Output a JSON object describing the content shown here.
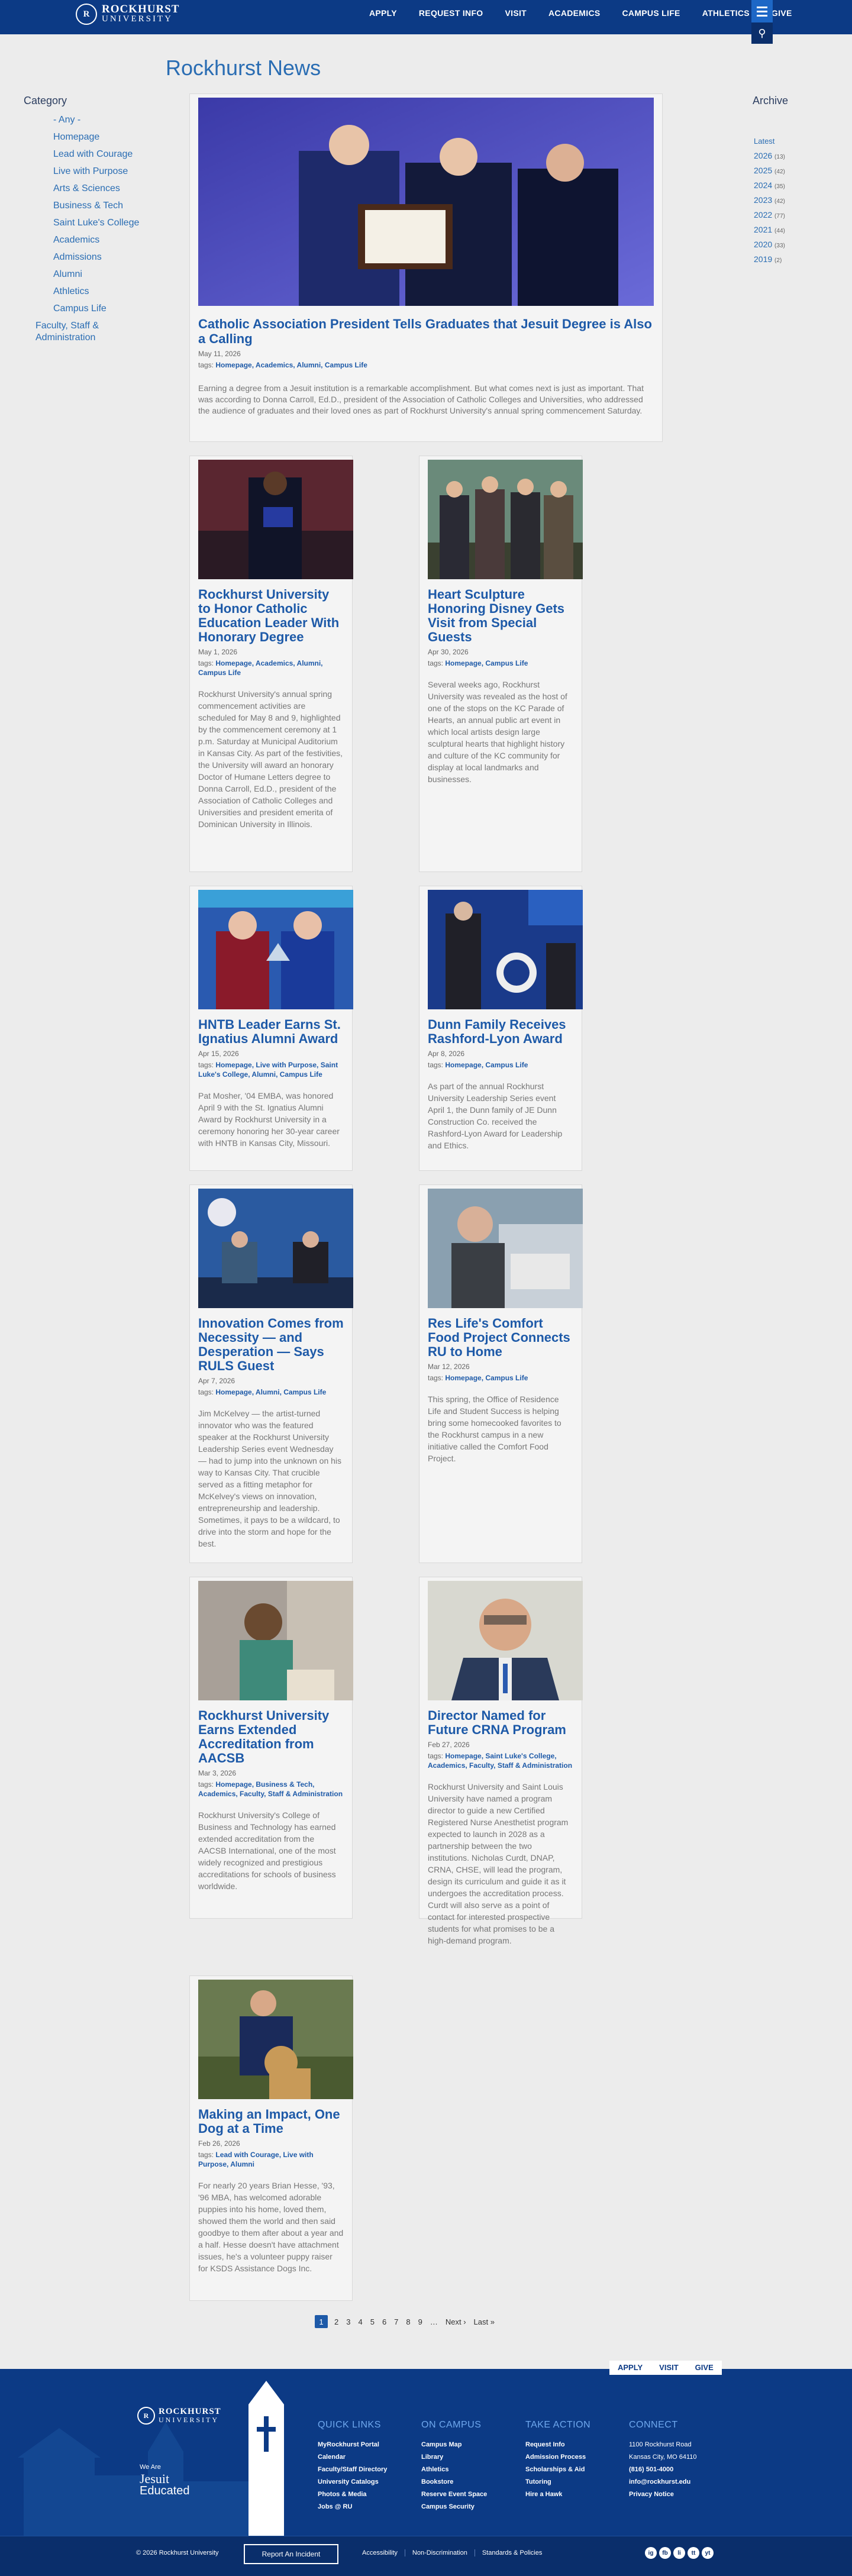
{
  "brand": {
    "name_line1": "ROCKHURST",
    "name_line2": "UNIVERSITY",
    "seal": "R"
  },
  "nav": [
    "APPLY",
    "REQUEST INFO",
    "VISIT",
    "ACADEMICS",
    "CAMPUS LIFE",
    "ATHLETICS",
    "GIVE"
  ],
  "page_title": "Rockhurst News",
  "category": {
    "heading": "Category",
    "items": [
      "- Any -",
      "Homepage",
      "Lead with Courage",
      "Live with Purpose",
      "Arts & Sciences",
      "Business & Tech",
      "Saint Luke's College",
      "Academics",
      "Admissions",
      "Alumni",
      "Athletics",
      "Campus Life",
      "Faculty, Staff & Administration"
    ]
  },
  "archive": {
    "heading": "Archive",
    "latest": "Latest",
    "years": [
      {
        "y": "2026",
        "c": "(13)"
      },
      {
        "y": "2025",
        "c": "(42)"
      },
      {
        "y": "2024",
        "c": "(35)"
      },
      {
        "y": "2023",
        "c": "(42)"
      },
      {
        "y": "2022",
        "c": "(77)"
      },
      {
        "y": "2021",
        "c": "(44)"
      },
      {
        "y": "2020",
        "c": "(33)"
      },
      {
        "y": "2019",
        "c": "(2)"
      }
    ]
  },
  "tags_label": "tags:",
  "featured": {
    "title": "Catholic Association President Tells Graduates that Jesuit Degree is Also a Calling",
    "date": "May 11, 2026",
    "tags": "Homepage, Academics, Alumni, Campus Life",
    "body": "Earning a degree from a Jesuit institution is a remarkable accomplishment. But what comes next is just as important. That was according to Donna Carroll, Ed.D., president of the Association of Catholic Colleges and Universities, who addressed the audience of graduates and their loved ones as part of Rockhurst University's annual spring commencement Saturday."
  },
  "articles": [
    {
      "title": "Rockhurst University to Honor Catholic Education Leader With Honorary Degree",
      "date": "May 1, 2026",
      "tags": "Homepage, Academics, Alumni, Campus Life",
      "body": "Rockhurst University's annual spring commencement activities are scheduled for May 8 and 9, highlighted by the commencement ceremony at 1 p.m. Saturday at Municipal Auditorium in Kansas City. As part of the festivities, the University will award an honorary Doctor of Humane Letters degree to Donna Carroll, Ed.D., president of the Association of Catholic Colleges and Universities and president emerita of Dominican University in Illinois."
    },
    {
      "title": "Heart Sculpture Honoring Disney Gets Visit from Special Guests",
      "date": "Apr 30, 2026",
      "tags": "Homepage, Campus Life",
      "body": "Several weeks ago, Rockhurst University was revealed as the host of one of the stops on the KC Parade of Hearts, an annual public art event in which local artists design large sculptural hearts that highlight history and culture of the KC community for display at local landmarks and businesses."
    },
    {
      "title": "HNTB Leader Earns St. Ignatius Alumni Award",
      "date": "Apr 15, 2026",
      "tags": "Homepage, Live with Purpose, Saint Luke's College, Alumni, Campus Life",
      "body": "Pat Mosher, '04 EMBA, was honored April 9 with the St. Ignatius Alumni Award by Rockhurst University in a ceremony honoring her 30-year career with HNTB in Kansas City, Missouri."
    },
    {
      "title": "Dunn Family Receives Rashford-Lyon Award",
      "date": "Apr 8, 2026",
      "tags": "Homepage, Campus Life",
      "body": "As part of the annual Rockhurst University Leadership Series event April 1, the Dunn family of JE Dunn Construction Co. received the Rashford-Lyon Award for Leadership and Ethics."
    },
    {
      "title": "Innovation Comes from Necessity — and Desperation — Says RULS Guest",
      "date": "Apr 7, 2026",
      "tags": "Homepage, Alumni, Campus Life",
      "body": "Jim McKelvey — the artist-turned innovator who was the featured speaker at the Rockhurst University Leadership Series event Wednesday — had to jump into the unknown on his way to Kansas City. That crucible served as a fitting metaphor for McKelvey's views on innovation, entrepreneurship and leadership. Sometimes, it pays to be a wildcard, to drive into the storm and hope for the best."
    },
    {
      "title": "Res Life's Comfort Food Project Connects RU to Home",
      "date": "Mar 12, 2026",
      "tags": "Homepage, Campus Life",
      "body": "This spring, the Office of Residence Life and Student Success is helping bring some homecooked favorites to the Rockhurst campus in a new initiative called the Comfort Food Project."
    },
    {
      "title": "Rockhurst University Earns Extended Accreditation from AACSB",
      "date": "Mar 3, 2026",
      "tags": "Homepage, Business & Tech, Academics, Faculty, Staff & Administration",
      "body": "Rockhurst University's College of Business and Technology has earned extended accreditation from the AACSB International, one of the most widely recognized and prestigious accreditations for schools of business worldwide."
    },
    {
      "title": "Director Named for Future CRNA Program",
      "date": "Feb 27, 2026",
      "tags": "Homepage, Saint Luke's College, Academics, Faculty, Staff & Administration",
      "body": "Rockhurst University and Saint Louis University have named a program director to guide a new Certified Registered Nurse Anesthetist program expected to launch in 2028 as a partnership between the two institutions. Nicholas Curdt, DNAP, CRNA, CHSE, will lead the program, design its curriculum and guide it as it undergoes the accreditation process. Curdt will also serve as a point of contact for interested prospective students for what promises to be a high-demand program."
    },
    {
      "title": "Making an Impact, One Dog at a Time",
      "date": "Feb 26, 2026",
      "tags": "Lead with Courage, Live with Purpose, Alumni",
      "body": "For nearly 20 years Brian Hesse, '93, '96 MBA, has welcomed adorable puppies into his home, loved them, showed them the world and then said goodbye to them after about a year and a half. Hesse doesn't have attachment issues, he's a volunteer puppy raiser for KSDS Assistance Dogs Inc."
    }
  ],
  "pager": {
    "pages": [
      "1",
      "2",
      "3",
      "4",
      "5",
      "6",
      "7",
      "8",
      "9",
      "…",
      "Next ›",
      "Last »"
    ]
  },
  "footer": {
    "tabs": [
      "APPLY",
      "VISIT",
      "GIVE"
    ],
    "tagline1": "We Are",
    "tagline2": "Jesuit",
    "tagline3": "Educated",
    "cols": [
      {
        "h": "QUICK LINKS",
        "items": [
          "MyRockhurst Portal",
          "Calendar",
          "Faculty/Staff Directory",
          "University Catalogs",
          "Photos & Media",
          "Jobs @ RU"
        ]
      },
      {
        "h": "ON CAMPUS",
        "items": [
          "Campus Map",
          "Library",
          "Athletics",
          "Bookstore",
          "Reserve Event Space",
          "Campus Security"
        ]
      },
      {
        "h": "TAKE ACTION",
        "items": [
          "Request Info",
          "Admission Process",
          "Scholarships & Aid",
          "Tutoring",
          "Hire a Hawk"
        ]
      },
      {
        "h": "CONNECT",
        "items": [
          "1100 Rockhurst Road",
          "Kansas City, MO 64110",
          "(816) 501-4000",
          "info@rockhurst.edu",
          "Privacy Notice"
        ]
      }
    ],
    "copyright": "© 2026 Rockhurst University",
    "report": "Report An Incident",
    "links": [
      "Accessibility",
      "Non-Discrimination",
      "Standards & Policies"
    ],
    "social": [
      "ig",
      "fb",
      "li",
      "tt",
      "yt"
    ]
  },
  "colors": {
    "brand_blue": "#0c3a85",
    "link_blue": "#1e5aa8"
  }
}
